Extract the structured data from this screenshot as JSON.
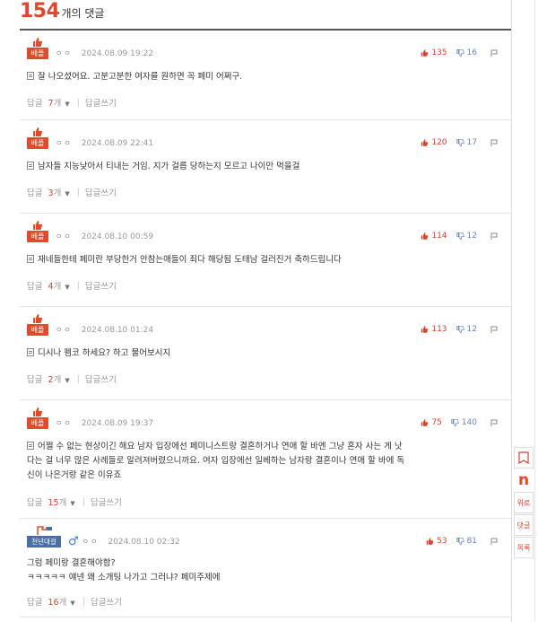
{
  "header": {
    "count": "154",
    "suffix": "개의 댓글"
  },
  "labels": {
    "reply": "답글",
    "reply_unit": "개",
    "write_reply": "답글쓰기",
    "best_badge": "베플",
    "rank_badge": "천년대걸",
    "dots": "ㅇㅇ"
  },
  "comments": [
    {
      "date": "2024.08.09 19:22",
      "up": "135",
      "down": "16",
      "body": "잘 나오셨어요. 고분고분한 여자를 원하면 꼭 페미 어쩌구.",
      "replies": "7"
    },
    {
      "date": "2024.08.09 22:41",
      "up": "120",
      "down": "17",
      "body": "남자들 지능낮아서 티내는 거임. 지가 걸릅 당하는지 모르고 나이만 먹을걸",
      "replies": "3"
    },
    {
      "date": "2024.08.10 00:59",
      "up": "114",
      "down": "12",
      "body": "재네들한테 페미란 부당한거 안참는애들이 죄다 해당됨 도태남 걸러진거 축하드립니다",
      "replies": "4"
    },
    {
      "date": "2024.08.10 01:24",
      "up": "113",
      "down": "12",
      "body": "디시나 펨코 하세요? 하고 물어보시지",
      "replies": "2"
    },
    {
      "date": "2024.08.09 19:37",
      "up": "75",
      "down": "140",
      "body_lines": [
        "어쩔 수 없는 현상이긴 해요 남자 입장에선 페미니스트랑 결혼하거나 연애 할 바엔 그냥 혼자 사는 게 낫",
        "다는 걸 너무 많은 사례들로 알려져버렸으니까요. 여자 입장에선 일베하는 남자랑 결혼이나 연애 할 바에 독",
        "신이 나은거랑 같은 이유죠"
      ],
      "replies": "15"
    },
    {
      "date": "2024.08.10 02:32",
      "up": "53",
      "down": "81",
      "body_lines": [
        "그럼 페미랑 결혼해야함?",
        "ㅋㅋㅋㅋㅋ 얘넨 왜 소개팅 나가고 그러냐? 페미주제에"
      ],
      "replies": "16"
    }
  ],
  "side": {
    "top": "위로",
    "comments": "댓글",
    "list": "목록",
    "n": "n"
  },
  "colors": {
    "accent": "#e04a2d",
    "down": "#6b86b5"
  }
}
